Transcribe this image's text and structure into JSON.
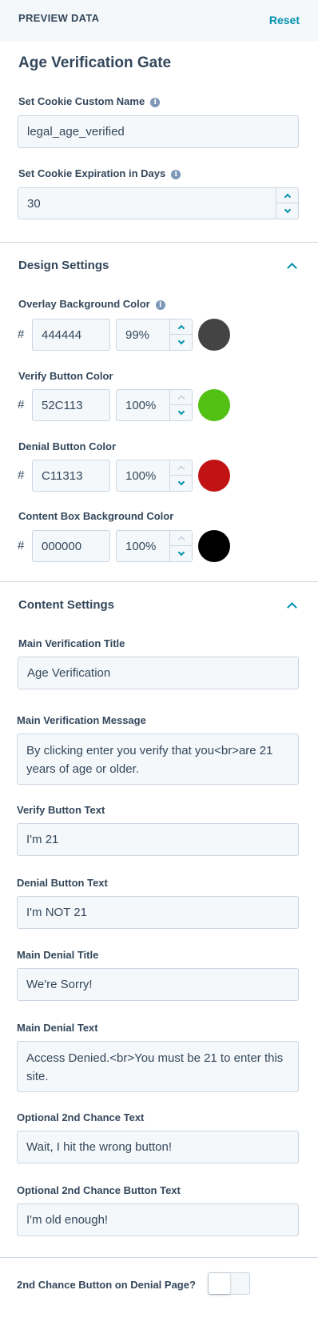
{
  "header": {
    "title": "PREVIEW DATA",
    "reset_label": "Reset"
  },
  "module_title": "Age Verification Gate",
  "cookie": {
    "name_label": "Set Cookie Custom Name",
    "name_value": "legal_age_verified",
    "expiration_label": "Set Cookie Expiration in Days",
    "expiration_value": "30"
  },
  "design": {
    "title": "Design Settings",
    "hash_symbol": "#",
    "colors": [
      {
        "label": "Overlay Background Color",
        "hex": "444444",
        "opacity": "99%",
        "swatch": "#444444"
      },
      {
        "label": "Verify Button Color",
        "hex": "52C113",
        "opacity": "100%",
        "swatch": "#52c113"
      },
      {
        "label": "Denial Button Color",
        "hex": "C11313",
        "opacity": "100%",
        "swatch": "#c11313"
      },
      {
        "label": "Content Box Background Color",
        "hex": "000000",
        "opacity": "100%",
        "swatch": "#000000"
      }
    ]
  },
  "content": {
    "title": "Content Settings",
    "fields": [
      {
        "label": "Main Verification Title",
        "value": "Age Verification"
      },
      {
        "label": "Main Verification Message",
        "value": "By clicking enter you verify that you<br>are 21 years of age or older."
      },
      {
        "label": "Verify Button Text",
        "value": "I'm 21"
      },
      {
        "label": "Denial Button Text",
        "value": "I'm NOT 21"
      },
      {
        "label": "Main Denial Title",
        "value": "We're Sorry!"
      },
      {
        "label": "Main Denial Text",
        "value": "Access Denied.<br>You must be 21 to enter this site."
      },
      {
        "label": "Optional 2nd Chance Text",
        "value": "Wait, I hit the wrong button!"
      },
      {
        "label": "Optional 2nd Chance Button Text",
        "value": "I'm old enough!"
      }
    ]
  },
  "second_chance": {
    "label": "2nd Chance Button on Denial Page?",
    "enabled": false
  }
}
